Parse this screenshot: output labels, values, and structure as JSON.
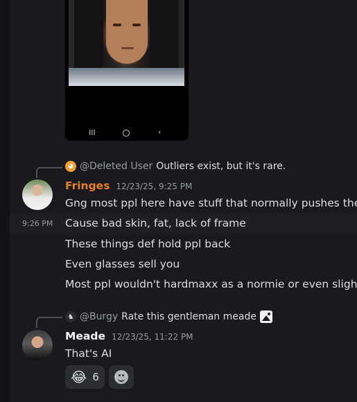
{
  "attachment": {
    "nav_recents": "III",
    "nav_back": "‹"
  },
  "messages": [
    {
      "reply": {
        "mention": "@Deleted User",
        "text": "Outliers exist, but it's rare."
      },
      "username": "Fringes",
      "username_color": "#e67e22",
      "timestamp": "12/23/25, 9:25 PM",
      "lines": [
        "Gng most ppl here have stuff that normally pushes them",
        "Cause bad skin, fat, lack of frame",
        "These things def hold ppl back",
        "Even glasses sell you",
        "Most ppl wouldn't hardmaxx as a normie or even slightly"
      ],
      "hover_time": "9:26 PM"
    },
    {
      "reply": {
        "mention": "@Burgy",
        "text": "Rate this gentleman meade"
      },
      "username": "Meade",
      "username_color": "#f2f3f5",
      "timestamp": "12/23/25, 11:22 PM",
      "lines": [
        "That's AI"
      ],
      "reactions": [
        {
          "emoji": "😂",
          "count": "6"
        }
      ]
    }
  ]
}
